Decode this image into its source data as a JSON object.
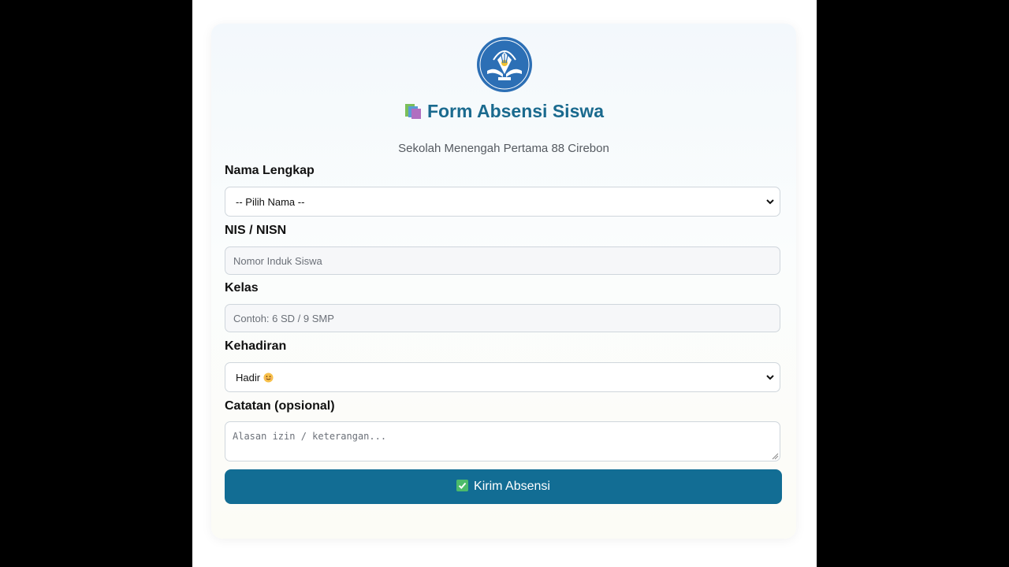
{
  "header": {
    "title": "Form Absensi Siswa",
    "subtitle": "Sekolah Menengah Pertama 88 Cirebon",
    "logo_text": "TUT WURI HANDAYANI",
    "title_icon": "books-icon"
  },
  "form": {
    "nama": {
      "label": "Nama Lengkap",
      "selected": "-- Pilih Nama --"
    },
    "nis": {
      "label": "NIS / NISN",
      "placeholder": "Nomor Induk Siswa"
    },
    "kelas": {
      "label": "Kelas",
      "placeholder": "Contoh: 6 SD / 9 SMP"
    },
    "kehadiran": {
      "label": "Kehadiran",
      "selected": "Hadir",
      "selected_icon": "smiley-icon"
    },
    "catatan": {
      "label": "Catatan (opsional)",
      "placeholder": "Alasan izin / keterangan..."
    },
    "submit_label": "Kirim Absensi",
    "submit_icon": "check-box-icon"
  },
  "colors": {
    "accent": "#126d94",
    "title": "#1a6a8e",
    "logo_blue": "#2c6fb5"
  }
}
